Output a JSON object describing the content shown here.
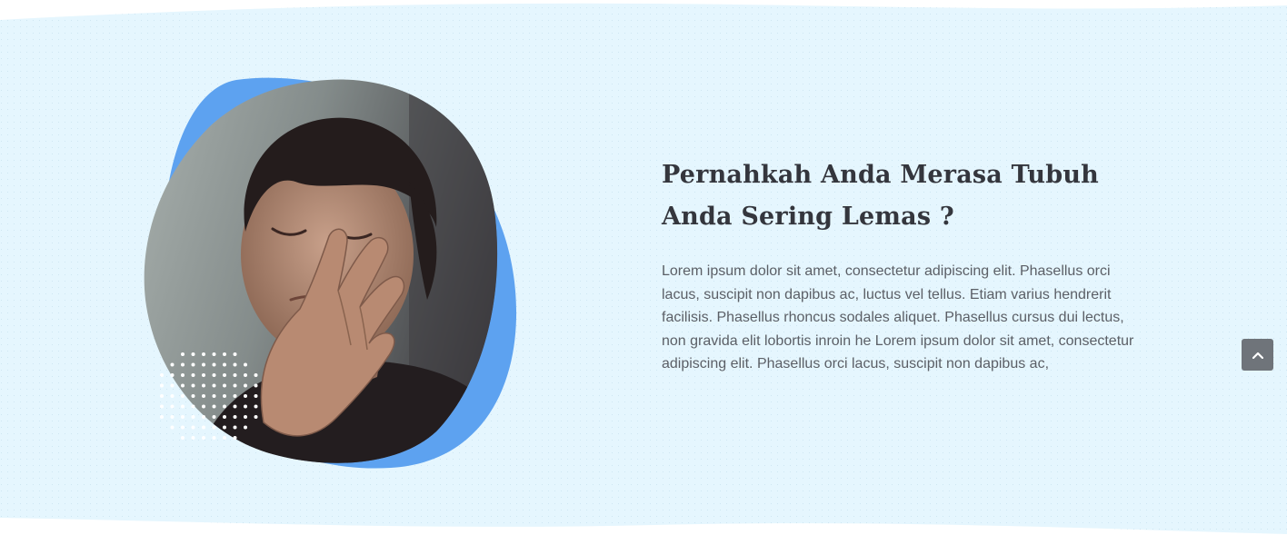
{
  "colors": {
    "section_background": "#e5f6fe",
    "blob_accent": "#5da2f0",
    "heading_text": "#34363d",
    "body_text": "#5b5f66",
    "scroll_button": "#6f747a"
  },
  "hero": {
    "image": {
      "icon": "photo-tired-man",
      "decoration": "white-dot-grid"
    },
    "heading": "Pernahkah Anda Merasa Tubuh Anda Sering Lemas ?",
    "body": "Lorem ipsum dolor sit amet, consectetur adipiscing elit. Phasellus orci lacus, suscipit non dapibus ac, luctus vel tellus. Etiam varius hendrerit facilisis. Phasellus rhoncus sodales aliquet. Phasellus cursus dui lectus, non gravida elit lobortis inroin he Lorem ipsum dolor sit amet, consectetur adipiscing elit. Phasellus orci lacus, suscipit non dapibus ac,"
  },
  "scroll_top": {
    "icon": "chevron-up-icon"
  }
}
